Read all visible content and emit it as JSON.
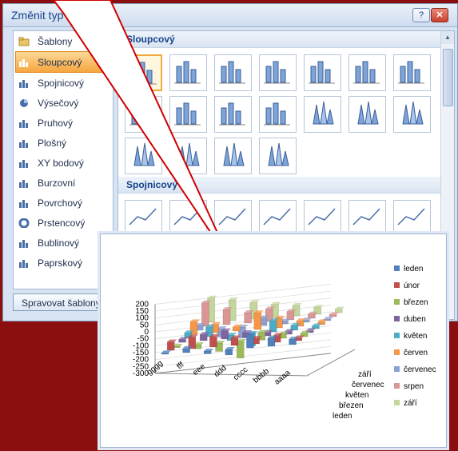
{
  "dialog": {
    "title": "Změnit typ grafu",
    "help_label": "?",
    "close_label": "✕"
  },
  "nav": [
    {
      "label": "Šablony",
      "icon": "folder-icon"
    },
    {
      "label": "Sloupcový",
      "icon": "column-chart-icon",
      "selected": true
    },
    {
      "label": "Spojnicový",
      "icon": "line-chart-icon"
    },
    {
      "label": "Výsečový",
      "icon": "pie-chart-icon"
    },
    {
      "label": "Pruhový",
      "icon": "bar-chart-icon"
    },
    {
      "label": "Plošný",
      "icon": "area-chart-icon"
    },
    {
      "label": "XY bodový",
      "icon": "scatter-chart-icon"
    },
    {
      "label": "Burzovní",
      "icon": "stock-chart-icon"
    },
    {
      "label": "Povrchový",
      "icon": "surface-chart-icon"
    },
    {
      "label": "Prstencový",
      "icon": "doughnut-chart-icon"
    },
    {
      "label": "Bublinový",
      "icon": "bubble-chart-icon"
    },
    {
      "label": "Paprskový",
      "icon": "radar-chart-icon"
    }
  ],
  "save_button_label": "Spravovat šablony",
  "sections": {
    "column": "Sloupcový",
    "line": "Spojnicový"
  },
  "colors": {
    "background": "#8b0f10",
    "dialog": "#d7e3f2",
    "selected_nav": "#f6a63f",
    "accent": "#15428b"
  },
  "chart_data": {
    "type": "bar",
    "style": "3d-column",
    "categories": [
      "gggg",
      "fff",
      "eee",
      "ddd",
      "cccc",
      "bbbb",
      "aaaa"
    ],
    "depth_labels": [
      "září",
      "červenec",
      "květen",
      "březen",
      "leden"
    ],
    "ylim": [
      -300,
      200
    ],
    "yticks": [
      "200",
      "150",
      "100",
      "50",
      "0",
      "-50",
      "-100",
      "-150",
      "-200",
      "-250",
      "-300"
    ],
    "legend_position": "right",
    "series": [
      {
        "name": "leden",
        "color": "#4f81bd",
        "values": [
          10,
          30,
          -20,
          -40,
          95,
          60,
          40
        ]
      },
      {
        "name": "únor",
        "color": "#c0504d",
        "values": [
          60,
          85,
          75,
          55,
          40,
          50,
          20
        ]
      },
      {
        "name": "březen",
        "color": "#9bbb59",
        "values": [
          -10,
          -30,
          -60,
          -120,
          55,
          30,
          25
        ]
      },
      {
        "name": "duben",
        "color": "#8064a2",
        "values": [
          20,
          45,
          60,
          35,
          25,
          20,
          15
        ]
      },
      {
        "name": "květen",
        "color": "#4bacc6",
        "values": [
          40,
          70,
          -40,
          -90,
          80,
          35,
          20
        ]
      },
      {
        "name": "červen",
        "color": "#f79646",
        "values": [
          90,
          60,
          30,
          120,
          70,
          40,
          20
        ]
      },
      {
        "name": "červenec",
        "color": "#8da0d2",
        "values": [
          35,
          -60,
          -80,
          55,
          20,
          15,
          10
        ]
      },
      {
        "name": "srpen",
        "color": "#d99694",
        "values": [
          170,
          110,
          75,
          90,
          60,
          30,
          15
        ]
      },
      {
        "name": "září",
        "color": "#c3d69b",
        "values": [
          175,
          150,
          120,
          95,
          75,
          50,
          25
        ]
      }
    ]
  }
}
